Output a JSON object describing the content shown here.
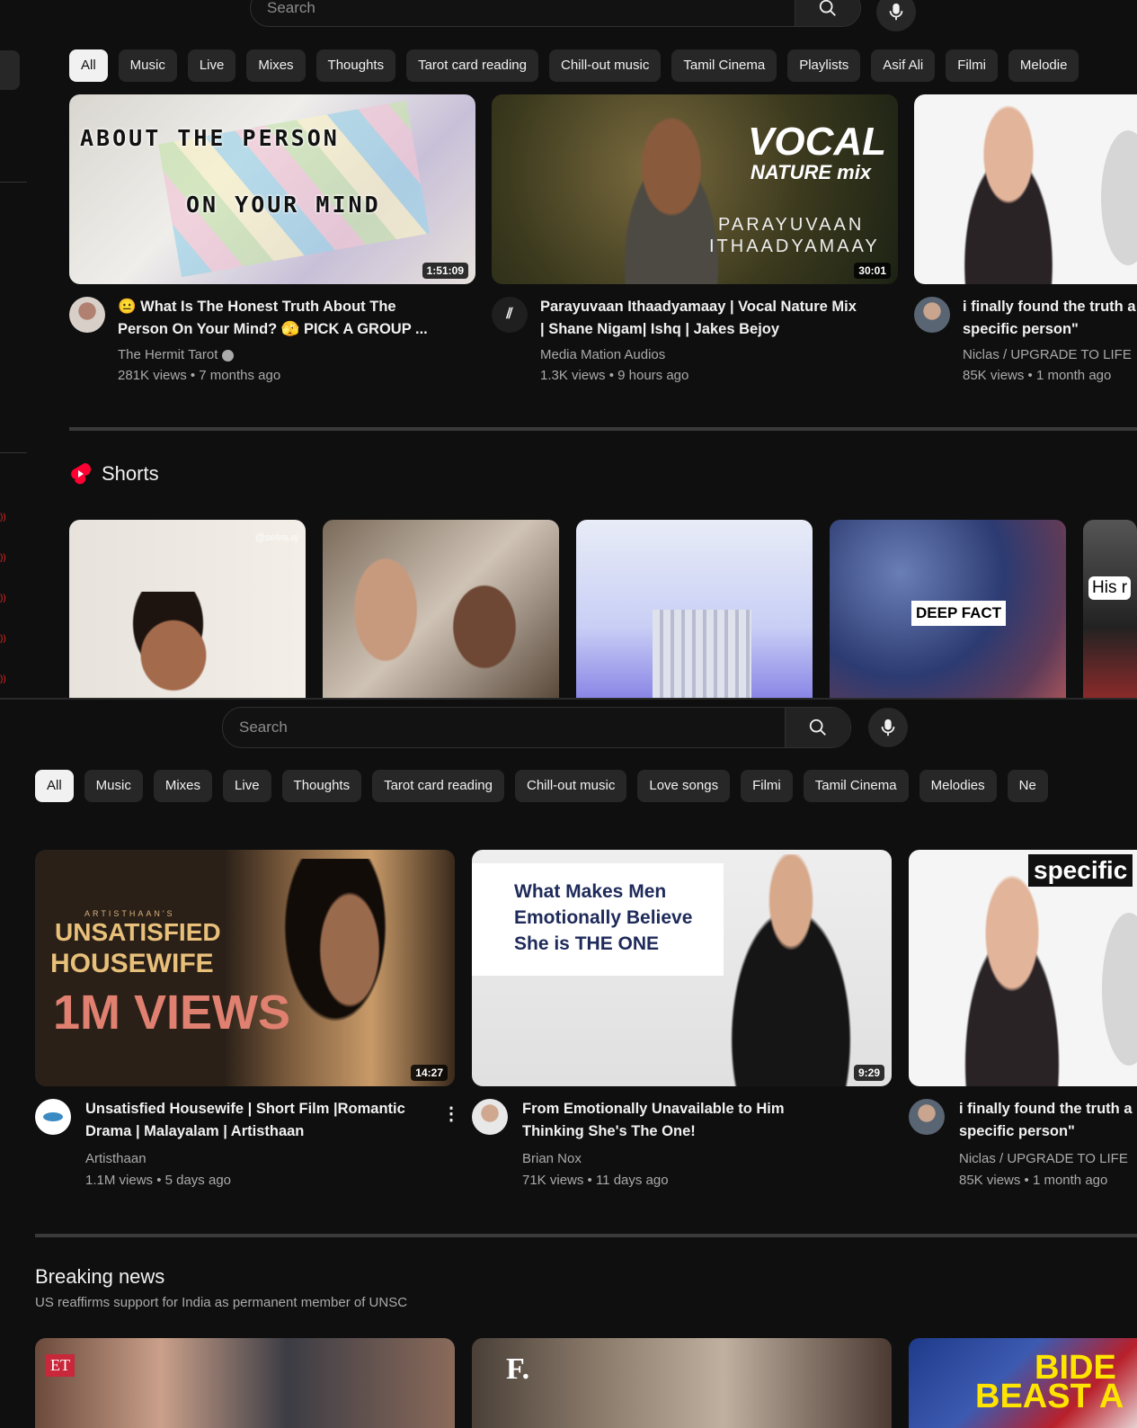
{
  "top": {
    "search_placeholder": "Search",
    "chips": [
      "All",
      "Music",
      "Live",
      "Mixes",
      "Thoughts",
      "Tarot card reading",
      "Chill-out music",
      "Tamil Cinema",
      "Playlists",
      "Asif Ali",
      "Filmi",
      "Melodie"
    ],
    "videos": [
      {
        "title1": "😐 What Is The Honest Truth About The",
        "title2": "Person On Your Mind? 🫣 PICK A GROUP ...",
        "channel": "The Hermit Tarot",
        "meta": "281K views • 7 months ago",
        "duration": "1:51:09",
        "thumb_text1": "ABOUT THE PERSON",
        "thumb_text2": "ON YOUR MIND"
      },
      {
        "title1": "Parayuvaan Ithaadyamaay | Vocal Nature Mix",
        "title2": "| Shane Nigam| Ishq | Jakes Bejoy",
        "channel": "Media Mation Audios",
        "meta": "1.3K views • 9 hours ago",
        "duration": "30:01",
        "thumb_text1": "VOCAL",
        "thumb_text2": "NATURE mix",
        "thumb_text3": "PARAYUVAAN",
        "thumb_text4": "ITHAADYAMAAY"
      },
      {
        "title1": "i finally found the truth a",
        "title2": "specific person\"",
        "channel": "Niclas / UPGRADE TO LIFE",
        "meta": "85K views • 1 month ago"
      }
    ],
    "shorts_label": "Shorts",
    "shorts": [
      {
        "overlay": "@selva.aj"
      },
      {
        "overlay": ""
      },
      {
        "overlay": ""
      },
      {
        "overlay": "DEEP FACT"
      },
      {
        "overlay": "His r"
      }
    ]
  },
  "bottom": {
    "search_placeholder": "Search",
    "chips": [
      "All",
      "Music",
      "Mixes",
      "Live",
      "Thoughts",
      "Tarot card reading",
      "Chill-out music",
      "Love songs",
      "Filmi",
      "Tamil Cinema",
      "Melodies",
      "Ne"
    ],
    "videos": [
      {
        "title1": "Unsatisfied Housewife | Short Film |Romantic",
        "title2": "Drama | Malayalam | Artisthaan",
        "channel": "Artisthaan",
        "meta": "1.1M views • 5 days ago",
        "duration": "14:27",
        "thumb_text1": "ARTISTHAAN'S",
        "thumb_text2": "UNSATISFIED",
        "thumb_text3": "HOUSEWIFE",
        "thumb_text4": "1M VIEWS"
      },
      {
        "title1": "From Emotionally Unavailable to Him",
        "title2": "Thinking She's The One!",
        "channel": "Brian Nox",
        "meta": "71K views • 11 days ago",
        "duration": "9:29",
        "thumb_text1": "What Makes Men",
        "thumb_text2": "Emotionally Believe",
        "thumb_text3": "She is THE ONE"
      },
      {
        "title1": "i finally found the truth a",
        "title2": "specific person\"",
        "channel": "Niclas / UPGRADE TO LIFE",
        "meta": "85K views • 1 month ago",
        "thumb_text1": "specific"
      }
    ],
    "news_heading": "Breaking news",
    "news_sub": "US reaffirms support for India as permanent member of UNSC",
    "news_thumbs": [
      {
        "badge": "ET"
      },
      {
        "badge": "F."
      },
      {
        "badge": "BIDE",
        "badge2": "BEAST A"
      }
    ]
  }
}
